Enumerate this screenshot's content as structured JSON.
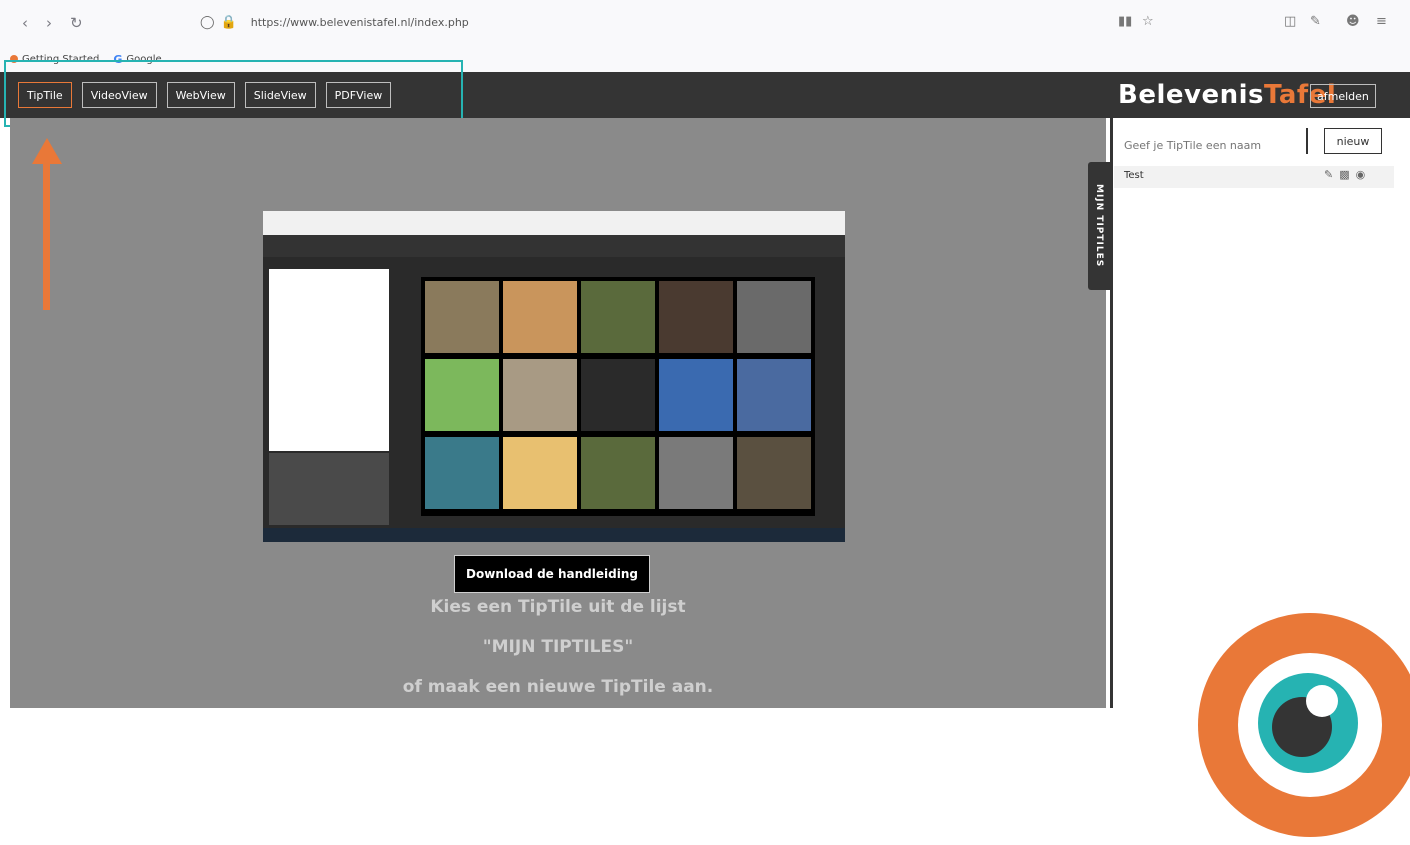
{
  "browser": {
    "url": "https://www.belevenistafel.nl/index.php",
    "bookmarks": [
      "Getting Started",
      "Google"
    ]
  },
  "header": {
    "tabs": [
      "TipTile",
      "VideoView",
      "WebView",
      "SlideView",
      "PDFView"
    ],
    "active_tab": 0,
    "logo_main": "Belevenis",
    "logo_accent": "Tafel",
    "logout_label": "afmelden"
  },
  "main": {
    "download_label": "Download de handleiding",
    "message_line1": "Kies een TipTile uit de lijst",
    "message_line2": "\"MIJN TIPTILES\"",
    "message_line3": "of maak een nieuwe TipTile aan."
  },
  "sidebar": {
    "handle_label": "MIJN TIPTILES",
    "name_placeholder": "Geef je TipTile een naam",
    "new_label": "nieuw",
    "items": [
      {
        "label": "Test"
      }
    ]
  },
  "colors": {
    "accent": "#e97838",
    "teal": "#26b3b2",
    "header_bg": "#343434",
    "main_bg": "#8a8a8a"
  }
}
